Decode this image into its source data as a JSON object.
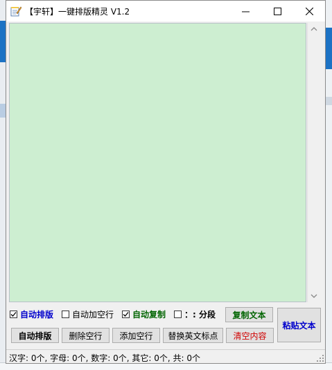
{
  "window": {
    "title": "【宇轩】一键排版精灵 V1.2"
  },
  "options": [
    {
      "label": "自动排版",
      "checked": true,
      "style": "blue-bold"
    },
    {
      "label": "自动加空行",
      "checked": false,
      "style": "plain"
    },
    {
      "label": "自动复制",
      "checked": true,
      "style": "green-bold"
    },
    {
      "label": "：: 分段",
      "checked": false,
      "style": "bold"
    }
  ],
  "buttons": {
    "copy_text": "复制文本",
    "paste_text": "粘贴文本",
    "auto_format": "自动排版",
    "delete_blank_lines": "删除空行",
    "add_blank_lines": "添加空行",
    "replace_punct": "替换英文标点",
    "clear_content": "清空内容"
  },
  "status": {
    "text": "汉字: 0个, 字母: 0个, 数字: 0个, 其它: 0个, 共: 0个"
  },
  "colors": {
    "editor_bg": "#cdeed1",
    "blue_label": "#0000cc",
    "green_label": "#006400",
    "red_label": "#d00000"
  },
  "icons": {
    "app": "notepad-pencil-icon",
    "minimize": "minimize-icon",
    "maximize": "maximize-icon",
    "close": "close-icon"
  }
}
